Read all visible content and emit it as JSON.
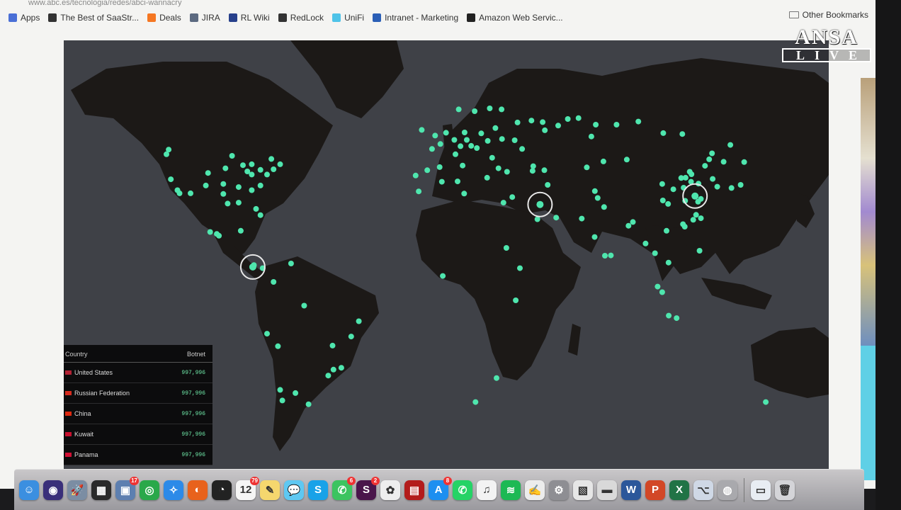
{
  "browser": {
    "url": "www.abc.es/tecnologia/redes/abci-wannacry",
    "bookmarks": [
      {
        "label": "Apps",
        "icon": "apps-grid-icon",
        "color": "#4a6fd6"
      },
      {
        "label": "The Best of SaaStr...",
        "icon": "saastr-icon",
        "color": "#333333"
      },
      {
        "label": "Deals",
        "icon": "hubspot-icon",
        "color": "#f57722"
      },
      {
        "label": "JIRA",
        "icon": "jira-icon",
        "color": "#5c6a80"
      },
      {
        "label": "RL Wiki",
        "icon": "confluence-icon",
        "color": "#27408b"
      },
      {
        "label": "RedLock",
        "icon": "lock-icon",
        "color": "#333333"
      },
      {
        "label": "UniFi",
        "icon": "unifi-icon",
        "color": "#4fc3e8"
      },
      {
        "label": "Intranet - Marketing",
        "icon": "sharepoint-icon",
        "color": "#2b5fb6"
      },
      {
        "label": "Amazon Web Servic...",
        "icon": "amazon-icon",
        "color": "#222222"
      }
    ],
    "other_bookmarks": "Other Bookmarks"
  },
  "watermark": {
    "brand": "ANSA",
    "sub": "LIVE"
  },
  "table": {
    "headers": {
      "country": "Country",
      "value": "Botnet"
    },
    "rows": [
      {
        "country": "United States",
        "value": "997,996",
        "flag": "#b22234"
      },
      {
        "country": "Russian Federation",
        "value": "997,996",
        "flag": "#d52b1e"
      },
      {
        "country": "China",
        "value": "997,996",
        "flag": "#de2910"
      },
      {
        "country": "Kuwait",
        "value": "997,996",
        "flag": "#c8102e"
      },
      {
        "country": "Panama",
        "value": "997,996",
        "flag": "#d21034"
      }
    ]
  },
  "colors": {
    "dot": "#4fe6ae",
    "land": "#1c1917",
    "ocean": "#3f4147",
    "accent_cyan": "#5fd0e6"
  },
  "infection_points": [
    [
      -122,
      47
    ],
    [
      -123,
      45.5
    ],
    [
      -121,
      37.5
    ],
    [
      -118,
      34
    ],
    [
      -112,
      33
    ],
    [
      -117,
      33
    ],
    [
      -104,
      39.5
    ],
    [
      -105,
      35.5
    ],
    [
      -97,
      32.8
    ],
    [
      -95,
      29.7
    ],
    [
      -90,
      30
    ],
    [
      -96,
      41
    ],
    [
      -93,
      45
    ],
    [
      -88,
      42
    ],
    [
      -84,
      42.3
    ],
    [
      -86,
      40
    ],
    [
      -84,
      39
    ],
    [
      -80,
      40.5
    ],
    [
      -77,
      39
    ],
    [
      -74,
      40.7
    ],
    [
      -71,
      42.3
    ],
    [
      -75,
      44
    ],
    [
      -80,
      35.5
    ],
    [
      -84,
      34
    ],
    [
      -82,
      28
    ],
    [
      -80,
      26
    ],
    [
      -90,
      35
    ],
    [
      -97,
      36
    ],
    [
      -100,
      20
    ],
    [
      -99,
      19.4
    ],
    [
      -103,
      20.6
    ],
    [
      -89,
      21
    ],
    [
      -83,
      10
    ],
    [
      -79,
      9
    ],
    [
      -74,
      4.6
    ],
    [
      -77,
      -12
    ],
    [
      -72,
      -16
    ],
    [
      -66,
      10.5
    ],
    [
      -58,
      -34.6
    ],
    [
      -70,
      -33.4
    ],
    [
      -71,
      -30
    ],
    [
      -64,
      -31
    ],
    [
      -47,
      -15.8
    ],
    [
      -43,
      -22.9
    ],
    [
      -46.6,
      -23.5
    ],
    [
      -49,
      -25.4
    ],
    [
      -38.5,
      -12.9
    ],
    [
      -35,
      -8
    ],
    [
      -60,
      -3
    ],
    [
      -9,
      38.7
    ],
    [
      -3.7,
      40.4
    ],
    [
      2,
      41.4
    ],
    [
      2.3,
      48.8
    ],
    [
      -1.5,
      47.2
    ],
    [
      4.9,
      52.4
    ],
    [
      13.4,
      52.5
    ],
    [
      8.7,
      50.1
    ],
    [
      11.5,
      48.1
    ],
    [
      16.4,
      48.2
    ],
    [
      19,
      47.5
    ],
    [
      21,
      52.2
    ],
    [
      14.4,
      50.1
    ],
    [
      12.5,
      41.9
    ],
    [
      9.2,
      45.5
    ],
    [
      23.7,
      38
    ],
    [
      26,
      44.4
    ],
    [
      28.9,
      41
    ],
    [
      24,
      49.8
    ],
    [
      30.5,
      50.4
    ],
    [
      27.5,
      53.9
    ],
    [
      37.6,
      55.7
    ],
    [
      30.3,
      59.9
    ],
    [
      18,
      59.3
    ],
    [
      10.7,
      59.9
    ],
    [
      24.9,
      60.2
    ],
    [
      -0.1,
      51.5
    ],
    [
      -6.2,
      53.3
    ],
    [
      32.8,
      39.9
    ],
    [
      44.5,
      40.2
    ],
    [
      36.3,
      50
    ],
    [
      39.7,
      47.2
    ],
    [
      44,
      56.3
    ],
    [
      49.1,
      55.8
    ],
    [
      50.1,
      53.2
    ],
    [
      56.2,
      54.7
    ],
    [
      60.6,
      56.8
    ],
    [
      65.5,
      57.1
    ],
    [
      73.4,
      55
    ],
    [
      82.9,
      55
    ],
    [
      92.9,
      56
    ],
    [
      104.3,
      52.3
    ],
    [
      113,
      52
    ],
    [
      135,
      48.5
    ],
    [
      131.9,
      43.1
    ],
    [
      44.8,
      41.7
    ],
    [
      49.9,
      40.4
    ],
    [
      69.3,
      41.3
    ],
    [
      71.4,
      51.2
    ],
    [
      76.9,
      43.2
    ],
    [
      35.2,
      31.8
    ],
    [
      31.2,
      30
    ],
    [
      46.7,
      24.7
    ],
    [
      47.9,
      29.4
    ],
    [
      51.4,
      35.7
    ],
    [
      55.3,
      25.2
    ],
    [
      67,
      24.9
    ],
    [
      73,
      33.7
    ],
    [
      74.3,
      31.5
    ],
    [
      77.2,
      28.6
    ],
    [
      72.9,
      19
    ],
    [
      77.6,
      13
    ],
    [
      80.3,
      13.1
    ],
    [
      88.4,
      22.6
    ],
    [
      90.4,
      23.8
    ],
    [
      96.2,
      16.9
    ],
    [
      100.5,
      13.8
    ],
    [
      106.7,
      10.8
    ],
    [
      105.8,
      21
    ],
    [
      101.7,
      3.1
    ],
    [
      103.8,
      1.3
    ],
    [
      106.8,
      -6.2
    ],
    [
      110.4,
      -7
    ],
    [
      114.1,
      22.3
    ],
    [
      113.3,
      23.1
    ],
    [
      121.5,
      31.2
    ],
    [
      120.2,
      30.3
    ],
    [
      118.8,
      32
    ],
    [
      114.3,
      30.6
    ],
    [
      116.4,
      39.9
    ],
    [
      117.2,
      39.1
    ],
    [
      123.4,
      41.8
    ],
    [
      126.6,
      45.8
    ],
    [
      104.1,
      30.7
    ],
    [
      106.5,
      29.6
    ],
    [
      108.9,
      34.3
    ],
    [
      113.6,
      34.8
    ],
    [
      117,
      36.7
    ],
    [
      120.4,
      36.1
    ],
    [
      121.5,
      25
    ],
    [
      126.9,
      37.6
    ],
    [
      129,
      35.1
    ],
    [
      139.7,
      35.7
    ],
    [
      135.5,
      34.7
    ],
    [
      141.3,
      43
    ],
    [
      103.8,
      36
    ],
    [
      87.6,
      43.8
    ],
    [
      114.5,
      38
    ],
    [
      112.5,
      37.9
    ],
    [
      125.3,
      43.9
    ],
    [
      118,
      24.5
    ],
    [
      119.3,
      26.1
    ],
    [
      120.9,
      14.6
    ],
    [
      151.2,
      -33.9
    ],
    [
      28,
      -26.2
    ],
    [
      18.4,
      -33.9
    ],
    [
      3.4,
      6.5
    ],
    [
      36.8,
      -1.3
    ],
    [
      -7.6,
      33.6
    ],
    [
      10.2,
      36.8
    ],
    [
      3,
      36.7
    ],
    [
      13.2,
      32.9
    ],
    [
      38.7,
      9
    ],
    [
      32.5,
      15.5
    ]
  ],
  "highlight_rings": [
    [
      -83.5,
      9.4
    ],
    [
      47.9,
      29.4
    ],
    [
      118.8,
      32.1
    ]
  ],
  "dock": {
    "icons": [
      {
        "name": "finder-icon",
        "glyph": "☺",
        "color": "#3b8fe0",
        "badge": ""
      },
      {
        "name": "siri-icon",
        "glyph": "◉",
        "color": "#3a2f7a",
        "badge": ""
      },
      {
        "name": "launchpad-icon",
        "glyph": "🚀",
        "color": "#7b8da3",
        "badge": ""
      },
      {
        "name": "mission-control-icon",
        "glyph": "▦",
        "color": "#2a2a2a",
        "badge": ""
      },
      {
        "name": "preview-icon",
        "glyph": "▣",
        "color": "#5d7fb0",
        "badge": "17"
      },
      {
        "name": "chrome-icon",
        "glyph": "◎",
        "color": "#2aa84a",
        "badge": ""
      },
      {
        "name": "safari-icon",
        "glyph": "✧",
        "color": "#2c8ae8",
        "badge": ""
      },
      {
        "name": "firefox-icon",
        "glyph": "◐",
        "color": "#e8621c",
        "badge": ""
      },
      {
        "name": "dashboard-icon",
        "glyph": "◔",
        "color": "#222222",
        "badge": ""
      },
      {
        "name": "calendar-icon",
        "glyph": "12",
        "color": "#f5f5f5",
        "badge": "79"
      },
      {
        "name": "notes-icon",
        "glyph": "✎",
        "color": "#f5d76e",
        "badge": ""
      },
      {
        "name": "messages-icon",
        "glyph": "💬",
        "color": "#5ec8f2",
        "badge": ""
      },
      {
        "name": "skype-icon",
        "glyph": "S",
        "color": "#18a2e8",
        "badge": ""
      },
      {
        "name": "facetime-icon",
        "glyph": "✆",
        "color": "#3cc460",
        "badge": "6"
      },
      {
        "name": "slack-icon",
        "glyph": "S",
        "color": "#4a154b",
        "badge": "2"
      },
      {
        "name": "photos-icon",
        "glyph": "✿",
        "color": "#eeeeee",
        "badge": ""
      },
      {
        "name": "photo-booth-icon",
        "glyph": "▤",
        "color": "#b31b1b",
        "badge": ""
      },
      {
        "name": "app-store-icon",
        "glyph": "A",
        "color": "#1d8ff0",
        "badge": "8"
      },
      {
        "name": "whatsapp-icon",
        "glyph": "✆",
        "color": "#25d366",
        "badge": ""
      },
      {
        "name": "itunes-icon",
        "glyph": "♫",
        "color": "#f3f3f3",
        "badge": ""
      },
      {
        "name": "spotify-icon",
        "glyph": "≋",
        "color": "#1db954",
        "badge": ""
      },
      {
        "name": "textedit-icon",
        "glyph": "✍",
        "color": "#ececec",
        "badge": ""
      },
      {
        "name": "system-preferences-icon",
        "glyph": "⚙",
        "color": "#8e8e93",
        "badge": ""
      },
      {
        "name": "keynote-icon",
        "glyph": "▧",
        "color": "#e6e6e6",
        "badge": ""
      },
      {
        "name": "printer-icon",
        "glyph": "▬",
        "color": "#d9d9d9",
        "badge": ""
      },
      {
        "name": "word-icon",
        "glyph": "W",
        "color": "#2b579a",
        "badge": ""
      },
      {
        "name": "powerpoint-icon",
        "glyph": "P",
        "color": "#d24726",
        "badge": ""
      },
      {
        "name": "excel-icon",
        "glyph": "X",
        "color": "#217346",
        "badge": ""
      },
      {
        "name": "network-utility-icon",
        "glyph": "⌥",
        "color": "#cfd8e6",
        "badge": ""
      },
      {
        "name": "disk-utility-icon",
        "glyph": "◍",
        "color": "#a9a9ad",
        "badge": ""
      }
    ],
    "trash_icons": [
      {
        "name": "downloads-folder-icon",
        "glyph": "▭",
        "color": "#e8edf3"
      },
      {
        "name": "trash-icon",
        "glyph": "🗑",
        "color": "#d4d4d8"
      }
    ]
  }
}
